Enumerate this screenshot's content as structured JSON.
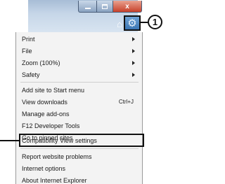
{
  "window": {
    "controls": {
      "minimize": "minimize",
      "maximize": "maximize",
      "close": "x"
    }
  },
  "toolbar": {
    "home_icon": "⌂",
    "favorites_icon": "★",
    "tools_icon": "⚙"
  },
  "callout": {
    "number": "1"
  },
  "menu": {
    "items": [
      {
        "label": "Print",
        "submenu": true
      },
      {
        "label": "File",
        "submenu": true
      },
      {
        "label": "Zoom (100%)",
        "submenu": true
      },
      {
        "label": "Safety",
        "submenu": true
      },
      {
        "label": "Add site to Start menu"
      },
      {
        "label": "View downloads",
        "shortcut": "Ctrl+J"
      },
      {
        "label": "Manage add-ons"
      },
      {
        "label": "F12 Developer Tools"
      },
      {
        "label": "Go to pinned sites"
      },
      {
        "label": "Compatibility View settings",
        "highlighted": true
      },
      {
        "label": "Report website problems"
      },
      {
        "label": "Internet options"
      },
      {
        "label": "About Internet Explorer"
      }
    ]
  }
}
